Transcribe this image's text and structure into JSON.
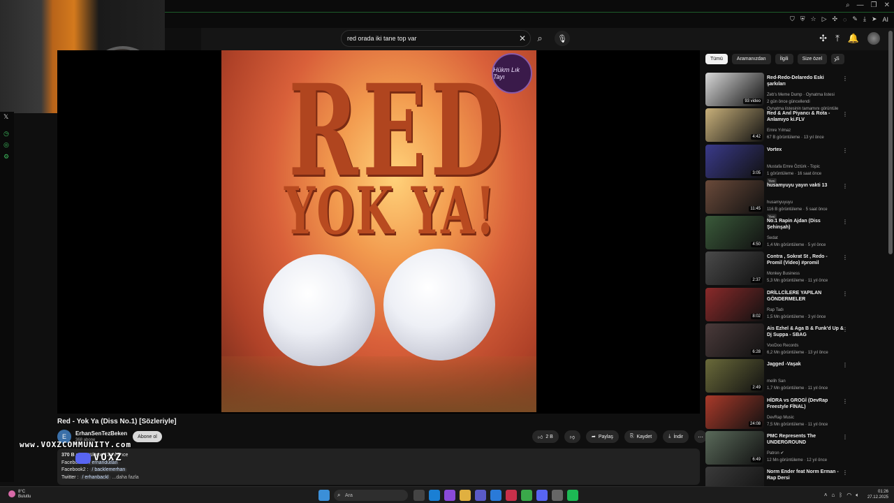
{
  "search": {
    "query": "red orada iki tane top var"
  },
  "video": {
    "title": "Red - Yok Ya (Diss No.1) [Sözleriyle]",
    "thumb_title_line1": "RED",
    "thumb_title_line2": "YOK YA!",
    "thumb_logo": "Hükm Lık Tayı"
  },
  "channel": {
    "avatar_letter": "E",
    "name": "ErhanSenTezBeken",
    "subscribers": "368 abone",
    "subscribe_label": "Abone ol"
  },
  "actions": {
    "likes": "2 B",
    "share": "Paylaş",
    "save": "Kaydet",
    "download": "İndir",
    "more": "⋯"
  },
  "description": {
    "line1_views": "370 B",
    "line1_rest": " görüntüleme  13 yıl önce",
    "line2_label": "Facebook : ",
    "line2_handle": "/ erhandutlan",
    "line3_label": "Facebook2 : ",
    "line3_handle": "/ backlemerhan",
    "line4_label": "Twitter : ",
    "line4_handle": "/ erhanbackl",
    "more": "...daha fazla"
  },
  "watermark": {
    "url": "www.VOXZCOMMUNITY.com",
    "brand": "VOXZ"
  },
  "chips": [
    "Tümü",
    "Aramanızdan",
    "İlgili",
    "Size özel",
    "S"
  ],
  "recommendations": [
    {
      "title": "Red-Redo-Delaredo Eski şarkıları",
      "meta1": "Zeb's Meme Dump · Oynatma listesi",
      "meta2": "2 gün önce güncellendi",
      "meta3": "Oynatma listesinin tamamını görüntüle",
      "duration": "93 video",
      "badge": "",
      "color": "#d8d8d8"
    },
    {
      "title": "Red & Anıl Piyancı & Rota - Anlamıyo ki.FLV",
      "meta1": "Emre Yılmaz",
      "meta2": "67 B görüntüleme · 13 yıl önce",
      "meta3": "",
      "duration": "4:42",
      "badge": "",
      "color": "#c8b07a"
    },
    {
      "title": "Vortex",
      "meta1": "Mustafa Emre Öztürk - Topic",
      "meta2": "1 görüntüleme · 16 saat önce",
      "meta3": "",
      "duration": "3:05",
      "badge": "Yeni",
      "color": "#3a3a8a"
    },
    {
      "title": "husamyuyu yayın vakti 13",
      "meta1": "husamyuyuyu",
      "meta2": "116 B görüntüleme · 5 saat önce",
      "meta3": "",
      "duration": "11:45",
      "badge": "Yeni",
      "color": "#6a4a3a"
    },
    {
      "title": "No.1  Rapin Ajdan (Diss Şehinşah)",
      "meta1": "Sedat",
      "meta2": "1,4 Mn görüntüleme · 5 yıl önce",
      "meta3": "",
      "duration": "4:50",
      "badge": "",
      "color": "#3a5a3a"
    },
    {
      "title": "Contra , Sokrat St , Redo - Promil (Video) #promil",
      "meta1": "Monkey Business",
      "meta2": "5,3 Mn görüntüleme · 11 yıl önce",
      "meta3": "",
      "duration": "2:37",
      "badge": "",
      "color": "#4a4a4a"
    },
    {
      "title": "DRİLLCİLERE YAPILAN GÖNDERMELER",
      "meta1": "Rap Tadı",
      "meta2": "1,5 Mn görüntüleme · 3 yıl önce",
      "meta3": "",
      "duration": "8:02",
      "badge": "",
      "color": "#8a2a2a"
    },
    {
      "title": "Ais Ezhel & Aga B & Funk'd Up & Dj Suppa - SBAG",
      "meta1": "VooDoo Records",
      "meta2": "6,2 Mn görüntüleme · 13 yıl önce",
      "meta3": "",
      "duration": "6:28",
      "badge": "",
      "color": "#4a3a3a"
    },
    {
      "title": "Jagged -Vaşak",
      "meta1": "melih San",
      "meta2": "1,7 Mn görüntüleme · 11 yıl önce",
      "meta3": "",
      "duration": "2:49",
      "badge": "",
      "color": "#6a6a3a"
    },
    {
      "title": "HİDRA vs GROGİ (DevRap Freestyle FİNAL)",
      "meta1": "DevRap Music",
      "meta2": "7,5 Mn görüntüleme · 11 yıl önce",
      "meta3": "",
      "duration": "24:08",
      "badge": "",
      "color": "#aa3a2a"
    },
    {
      "title": "PMC Represents The UNDERGROUND",
      "meta1": "Patron ✔",
      "meta2": "12 Mn görüntüleme · 12 yıl önce",
      "meta3": "",
      "duration": "6:49",
      "badge": "",
      "color": "#5a6a5a"
    },
    {
      "title": "Norm Ender feat Norm Erman - Rap Dersi",
      "meta1": "",
      "meta2": "",
      "meta3": "",
      "duration": "",
      "badge": "",
      "color": "#3a3a3a"
    }
  ],
  "taskbar": {
    "temp": "8°C",
    "weather": "Bulutlu",
    "search_placeholder": "Ara",
    "time": "01:26",
    "date": "27.12.2025"
  },
  "extension": {
    "ai_label": "AI"
  }
}
